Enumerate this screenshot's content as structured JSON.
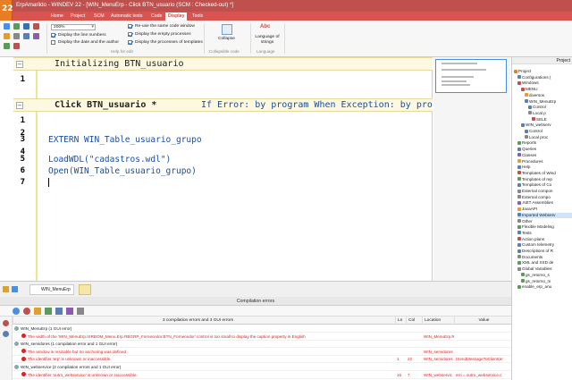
{
  "window": {
    "logo_text": "22",
    "title": "ErpAmarildo - WINDEV 22 - [WIN_MenuErp - Click BTN_usuario (SCM : Checked-out) *]"
  },
  "menu_tabs": [
    "Home",
    "Project",
    "SCM",
    "Automatic tests",
    "Code",
    "Display",
    "Tools"
  ],
  "ribbon": {
    "zoom_value": "200%",
    "options_left": [
      {
        "label": "Display the line numbers",
        "checked": true
      },
      {
        "label": "Display the date and the author",
        "checked": false
      }
    ],
    "options_mid": [
      {
        "label": "Re-use the same code window",
        "checked": true
      },
      {
        "label": "Display the empty processes",
        "checked": true
      },
      {
        "label": "Display the processes of templates",
        "checked": true
      }
    ],
    "group_help": "Help for edit",
    "collapse_label": "Collapse",
    "group_collapse": "Collapsible code",
    "lang_icon": "Abc",
    "lang_label": "Language of strings",
    "group_language": "Language"
  },
  "editor": {
    "section1": "Initializing BTN_usuario",
    "section2": "Click BTN_usuario *",
    "section2_hint": "If Error: by program When Exception: by program",
    "lines": [
      {
        "no": "1",
        "text": ""
      },
      {
        "no": "1",
        "text": ""
      },
      {
        "no": "2",
        "text": ""
      },
      {
        "no": "3",
        "text": "EXTERN WIN_Table_usuario_grupo"
      },
      {
        "no": "4",
        "text": ""
      },
      {
        "no": "5",
        "text": "LoadWDL(\"cadastros.wdl\")"
      },
      {
        "no": "6",
        "text": "Open(WIN_Table_usuario_grupo)"
      },
      {
        "no": "7",
        "text": ""
      }
    ]
  },
  "project": {
    "header": "Project",
    "items": [
      {
        "label": "Project",
        "indent": 0,
        "color": "#e67e22"
      },
      {
        "label": "Configurations (",
        "indent": 1,
        "color": "#5a7fb5"
      },
      {
        "label": "Windows",
        "indent": 1,
        "color": "#c0504d"
      },
      {
        "label": "MENU",
        "indent": 2,
        "color": "#c0504d"
      },
      {
        "label": "diversos",
        "indent": 3,
        "color": "#e0a030"
      },
      {
        "label": "WIN_MenuErp",
        "indent": 3,
        "color": "#5a7fb5"
      },
      {
        "label": "Control",
        "indent": 4,
        "color": "#5a7fb5"
      },
      {
        "label": "Local p",
        "indent": 4,
        "color": "#888888"
      },
      {
        "label": "SELE",
        "indent": 5,
        "color": "#c0504d"
      },
      {
        "label": "WIN_webserv",
        "indent": 2,
        "color": "#5a7fb5"
      },
      {
        "label": "Control",
        "indent": 3,
        "color": "#5a7fb5"
      },
      {
        "label": "Local proc",
        "indent": 3,
        "color": "#888888"
      },
      {
        "label": "Reports",
        "indent": 1,
        "color": "#5a9a5a"
      },
      {
        "label": "Queries",
        "indent": 1,
        "color": "#5a7fb5"
      },
      {
        "label": "Classes",
        "indent": 1,
        "color": "#8a5ab5"
      },
      {
        "label": "Procedures",
        "indent": 1,
        "color": "#e0a030"
      },
      {
        "label": "Help",
        "indent": 1,
        "color": "#5a7fb5"
      },
      {
        "label": "Templates of Wind",
        "indent": 1,
        "color": "#c0504d"
      },
      {
        "label": "Templates of rep",
        "indent": 1,
        "color": "#5a9a5a"
      },
      {
        "label": "Templates of Co",
        "indent": 1,
        "color": "#5a7fb5"
      },
      {
        "label": "External compon",
        "indent": 1,
        "color": "#888888"
      },
      {
        "label": "External compo",
        "indent": 1,
        "color": "#888888"
      },
      {
        "label": ".NET Assemblies",
        "indent": 1,
        "color": "#8a5ab5"
      },
      {
        "label": "JavaAPI",
        "indent": 1,
        "color": "#e0a030"
      },
      {
        "label": "Imported Webserv",
        "indent": 1,
        "color": "#5a7fb5",
        "selected": true
      },
      {
        "label": "Other",
        "indent": 1,
        "color": "#888888"
      },
      {
        "label": "Flexible Modeling",
        "indent": 1,
        "color": "#5a9a5a"
      },
      {
        "label": "Tests",
        "indent": 1,
        "color": "#5a7fb5"
      },
      {
        "label": "Action plans",
        "indent": 1,
        "color": "#c0504d"
      },
      {
        "label": "Custom telemetry",
        "indent": 1,
        "color": "#5a7fb5"
      },
      {
        "label": "Descriptions of R",
        "indent": 1,
        "color": "#5a7fb5"
      },
      {
        "label": "Documents",
        "indent": 1,
        "color": "#888888"
      },
      {
        "label": "XML and XSD de",
        "indent": 1,
        "color": "#5a9a5a"
      },
      {
        "label": "Global Variables",
        "indent": 1,
        "color": "#888888"
      },
      {
        "label": "gs_retorno_s",
        "indent": 2,
        "color": "#5a9a5a"
      },
      {
        "label": "gs_retorno_m",
        "indent": 2,
        "color": "#5a9a5a"
      },
      {
        "label": "enable_erp_anu",
        "indent": 1,
        "color": "#5a9a5a"
      }
    ]
  },
  "bottom_tabs": [
    "WIN_MenuErp"
  ],
  "compilation": {
    "title": "Compilation errors",
    "summary": "3 compilation errors and 3 GUI errors",
    "col_ln": "Ln",
    "col_col": "Col",
    "col_location": "Location",
    "col_value": "Value",
    "rows": [
      {
        "type": "grp",
        "text": "WIN_MenuErp (1 GUI error)",
        "ln": "",
        "col": "",
        "loc": "",
        "val": ""
      },
      {
        "type": "err",
        "text": "The width of the 'WIN_MenuErp.ISRBOM_Menu.Erp.RBGRP_Fornecedor.BTN_Fornecedor' control is too small to display the caption property in English",
        "ln": "",
        "col": "",
        "loc": "WIN_MenuErp.RIB",
        "val": ""
      },
      {
        "type": "grp",
        "text": "WIN_servidores (1 compilation error and 1 GUI error)",
        "ln": "",
        "col": "",
        "loc": "",
        "val": ""
      },
      {
        "type": "err",
        "text": "The window is resizable but no anchoring was defined",
        "ln": "",
        "col": "",
        "loc": "WIN_servidores",
        "val": ""
      },
      {
        "type": "err",
        "text": "The identifier 'erp' is unknown or inaccessible.",
        "ln": "1",
        "col": "22",
        "loc": "WIN_servidores",
        "val": "ISendMessageToClient(er"
      },
      {
        "type": "grp",
        "text": "WIN_webservice (2 compilation errors and 1 GUI error)",
        "ln": "",
        "col": "",
        "loc": "",
        "val": ""
      },
      {
        "type": "err",
        "text": "The identifier 'outro_webservice' is unknown or inaccessible.",
        "ln": "16",
        "col": "7",
        "loc": "WIN_webservic",
        "val": "erri = outro_webservice.c"
      }
    ]
  }
}
